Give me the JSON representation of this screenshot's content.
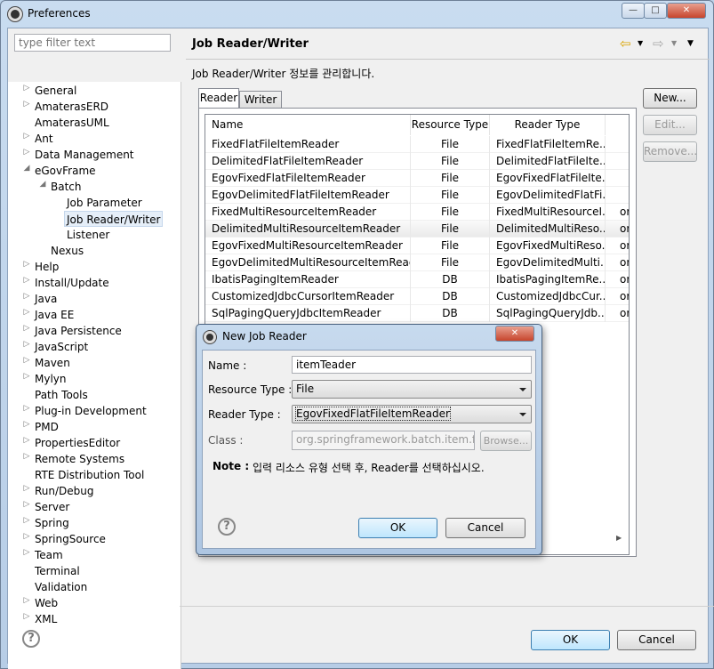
{
  "window": {
    "title": "Preferences",
    "min": "—",
    "max": "□",
    "close": "✕"
  },
  "filter": {
    "placeholder": "type filter text"
  },
  "tree": [
    {
      "label": "General",
      "level": 0,
      "arrow": "▷"
    },
    {
      "label": "AmaterasERD",
      "level": 0,
      "arrow": "▷"
    },
    {
      "label": "AmaterasUML",
      "level": 0,
      "arrow": ""
    },
    {
      "label": "Ant",
      "level": 0,
      "arrow": "▷"
    },
    {
      "label": "Data Management",
      "level": 0,
      "arrow": "▷"
    },
    {
      "label": "eGovFrame",
      "level": 0,
      "arrow": "◢"
    },
    {
      "label": "Batch",
      "level": 1,
      "arrow": "◢"
    },
    {
      "label": "Job Parameter",
      "level": 2,
      "arrow": ""
    },
    {
      "label": "Job Reader/Writer",
      "level": 2,
      "arrow": "",
      "selected": true
    },
    {
      "label": "Listener",
      "level": 2,
      "arrow": ""
    },
    {
      "label": "Nexus",
      "level": 1,
      "arrow": ""
    },
    {
      "label": "Help",
      "level": 0,
      "arrow": "▷"
    },
    {
      "label": "Install/Update",
      "level": 0,
      "arrow": "▷"
    },
    {
      "label": "Java",
      "level": 0,
      "arrow": "▷"
    },
    {
      "label": "Java EE",
      "level": 0,
      "arrow": "▷"
    },
    {
      "label": "Java Persistence",
      "level": 0,
      "arrow": "▷"
    },
    {
      "label": "JavaScript",
      "level": 0,
      "arrow": "▷"
    },
    {
      "label": "Maven",
      "level": 0,
      "arrow": "▷"
    },
    {
      "label": "Mylyn",
      "level": 0,
      "arrow": "▷"
    },
    {
      "label": "Path Tools",
      "level": 0,
      "arrow": ""
    },
    {
      "label": "Plug-in Development",
      "level": 0,
      "arrow": "▷"
    },
    {
      "label": "PMD",
      "level": 0,
      "arrow": "▷"
    },
    {
      "label": "PropertiesEditor",
      "level": 0,
      "arrow": "▷"
    },
    {
      "label": "Remote Systems",
      "level": 0,
      "arrow": "▷"
    },
    {
      "label": "RTE Distribution Tool",
      "level": 0,
      "arrow": ""
    },
    {
      "label": "Run/Debug",
      "level": 0,
      "arrow": "▷"
    },
    {
      "label": "Server",
      "level": 0,
      "arrow": "▷"
    },
    {
      "label": "Spring",
      "level": 0,
      "arrow": "▷"
    },
    {
      "label": "SpringSource",
      "level": 0,
      "arrow": "▷"
    },
    {
      "label": "Team",
      "level": 0,
      "arrow": "▷"
    },
    {
      "label": "Terminal",
      "level": 0,
      "arrow": ""
    },
    {
      "label": "Validation",
      "level": 0,
      "arrow": ""
    },
    {
      "label": "Web",
      "level": 0,
      "arrow": "▷"
    },
    {
      "label": "XML",
      "level": 0,
      "arrow": "▷"
    }
  ],
  "page": {
    "title": "Job Reader/Writer",
    "description": "Job Reader/Writer 정보를 관리합니다.",
    "nav_back": "⇦",
    "nav_fwd": "⇨",
    "menu": "▼"
  },
  "tabs": [
    {
      "label": "Reader",
      "active": true
    },
    {
      "label": "Writer",
      "active": false
    }
  ],
  "table": {
    "columns": [
      "Name",
      "Resource Type",
      "Reader Type",
      ""
    ],
    "rows": [
      [
        "FixedFlatFileItemReader",
        "File",
        "FixedFlatFileItemRe...",
        ""
      ],
      [
        "DelimitedFlatFileItemReader",
        "File",
        "DelimitedFlatFileIte...",
        ""
      ],
      [
        "EgovFixedFlatFileItemReader",
        "File",
        "EgovFixedFlatFileIte...",
        ""
      ],
      [
        "EgovDelimitedFlatFileItemReader",
        "File",
        "EgovDelimitedFlatFi...",
        ""
      ],
      [
        "FixedMultiResourceItemReader",
        "File",
        "FixedMultiResourceI...",
        "or"
      ],
      [
        "DelimitedMultiResourceItemReader",
        "File",
        "DelimitedMultiReso...",
        "or"
      ],
      [
        "EgovFixedMultiResourceItemReader",
        "File",
        "EgovFixedMultiReso...",
        "or"
      ],
      [
        "EgovDelimitedMultiResourceItemReader",
        "File",
        "EgovDelimitedMulti...",
        "or"
      ],
      [
        "IbatisPagingItemReader",
        "DB",
        "IbatisPagingItemRe...",
        "org"
      ],
      [
        "CustomizedJdbcCursorItemReader",
        "DB",
        "CustomizedJdbcCur...",
        "org"
      ],
      [
        "SqlPagingQueryJdbcItemReader",
        "DB",
        "SqlPagingQueryJdb...",
        "org"
      ]
    ]
  },
  "side_buttons": {
    "new": "New...",
    "edit": "Edit...",
    "remove": "Remove..."
  },
  "footer": {
    "help": "?",
    "ok": "OK",
    "cancel": "Cancel"
  },
  "dialog": {
    "title": "New Job Reader",
    "close": "✕",
    "name_label": "Name :",
    "name_value": "itemTeader",
    "resource_label": "Resource Type :",
    "resource_value": "File",
    "reader_label": "Reader Type :",
    "reader_value": "EgovFixedFlatFileItemReader",
    "class_label": "Class :",
    "class_value": "org.springframework.batch.item.file.F",
    "browse": "Browse...",
    "note_label": "Note :",
    "note_text": "입력 리소스 유형 선택 후, Reader를 선택하십시오.",
    "help": "?",
    "ok": "OK",
    "cancel": "Cancel"
  }
}
